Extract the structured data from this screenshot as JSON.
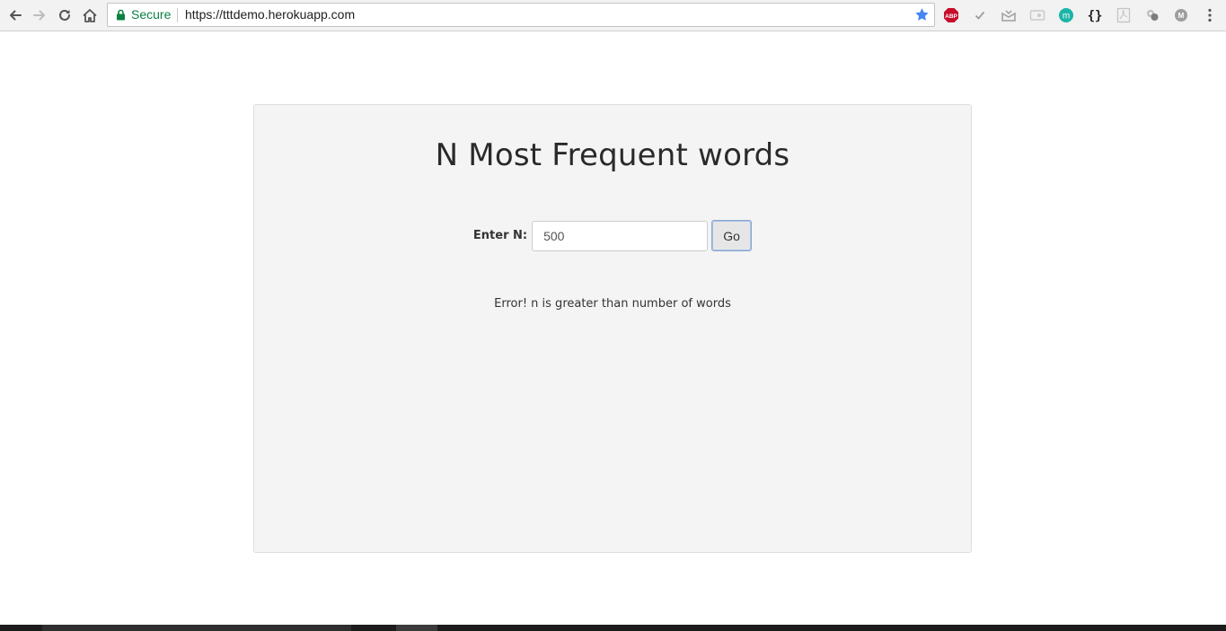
{
  "browser": {
    "secure_label": "Secure",
    "url": "https://tttdemo.herokuapp.com",
    "extensions": [
      "adblock-plus-icon",
      "checkmark-icon",
      "inbox-icon",
      "cast-icon",
      "mercury-icon",
      "json-braces-icon",
      "pdf-icon",
      "puzzle-icon",
      "profile-m-icon",
      "menu-dots-icon"
    ]
  },
  "page": {
    "title": "N Most Frequent words",
    "input_label": "Enter N:",
    "input_value": "500",
    "go_button": "Go",
    "error_message": "Error! n is greater than number of words"
  },
  "colors": {
    "secure_green": "#0b8043",
    "panel_bg": "#f4f4f4",
    "star_blue": "#4285f4"
  }
}
